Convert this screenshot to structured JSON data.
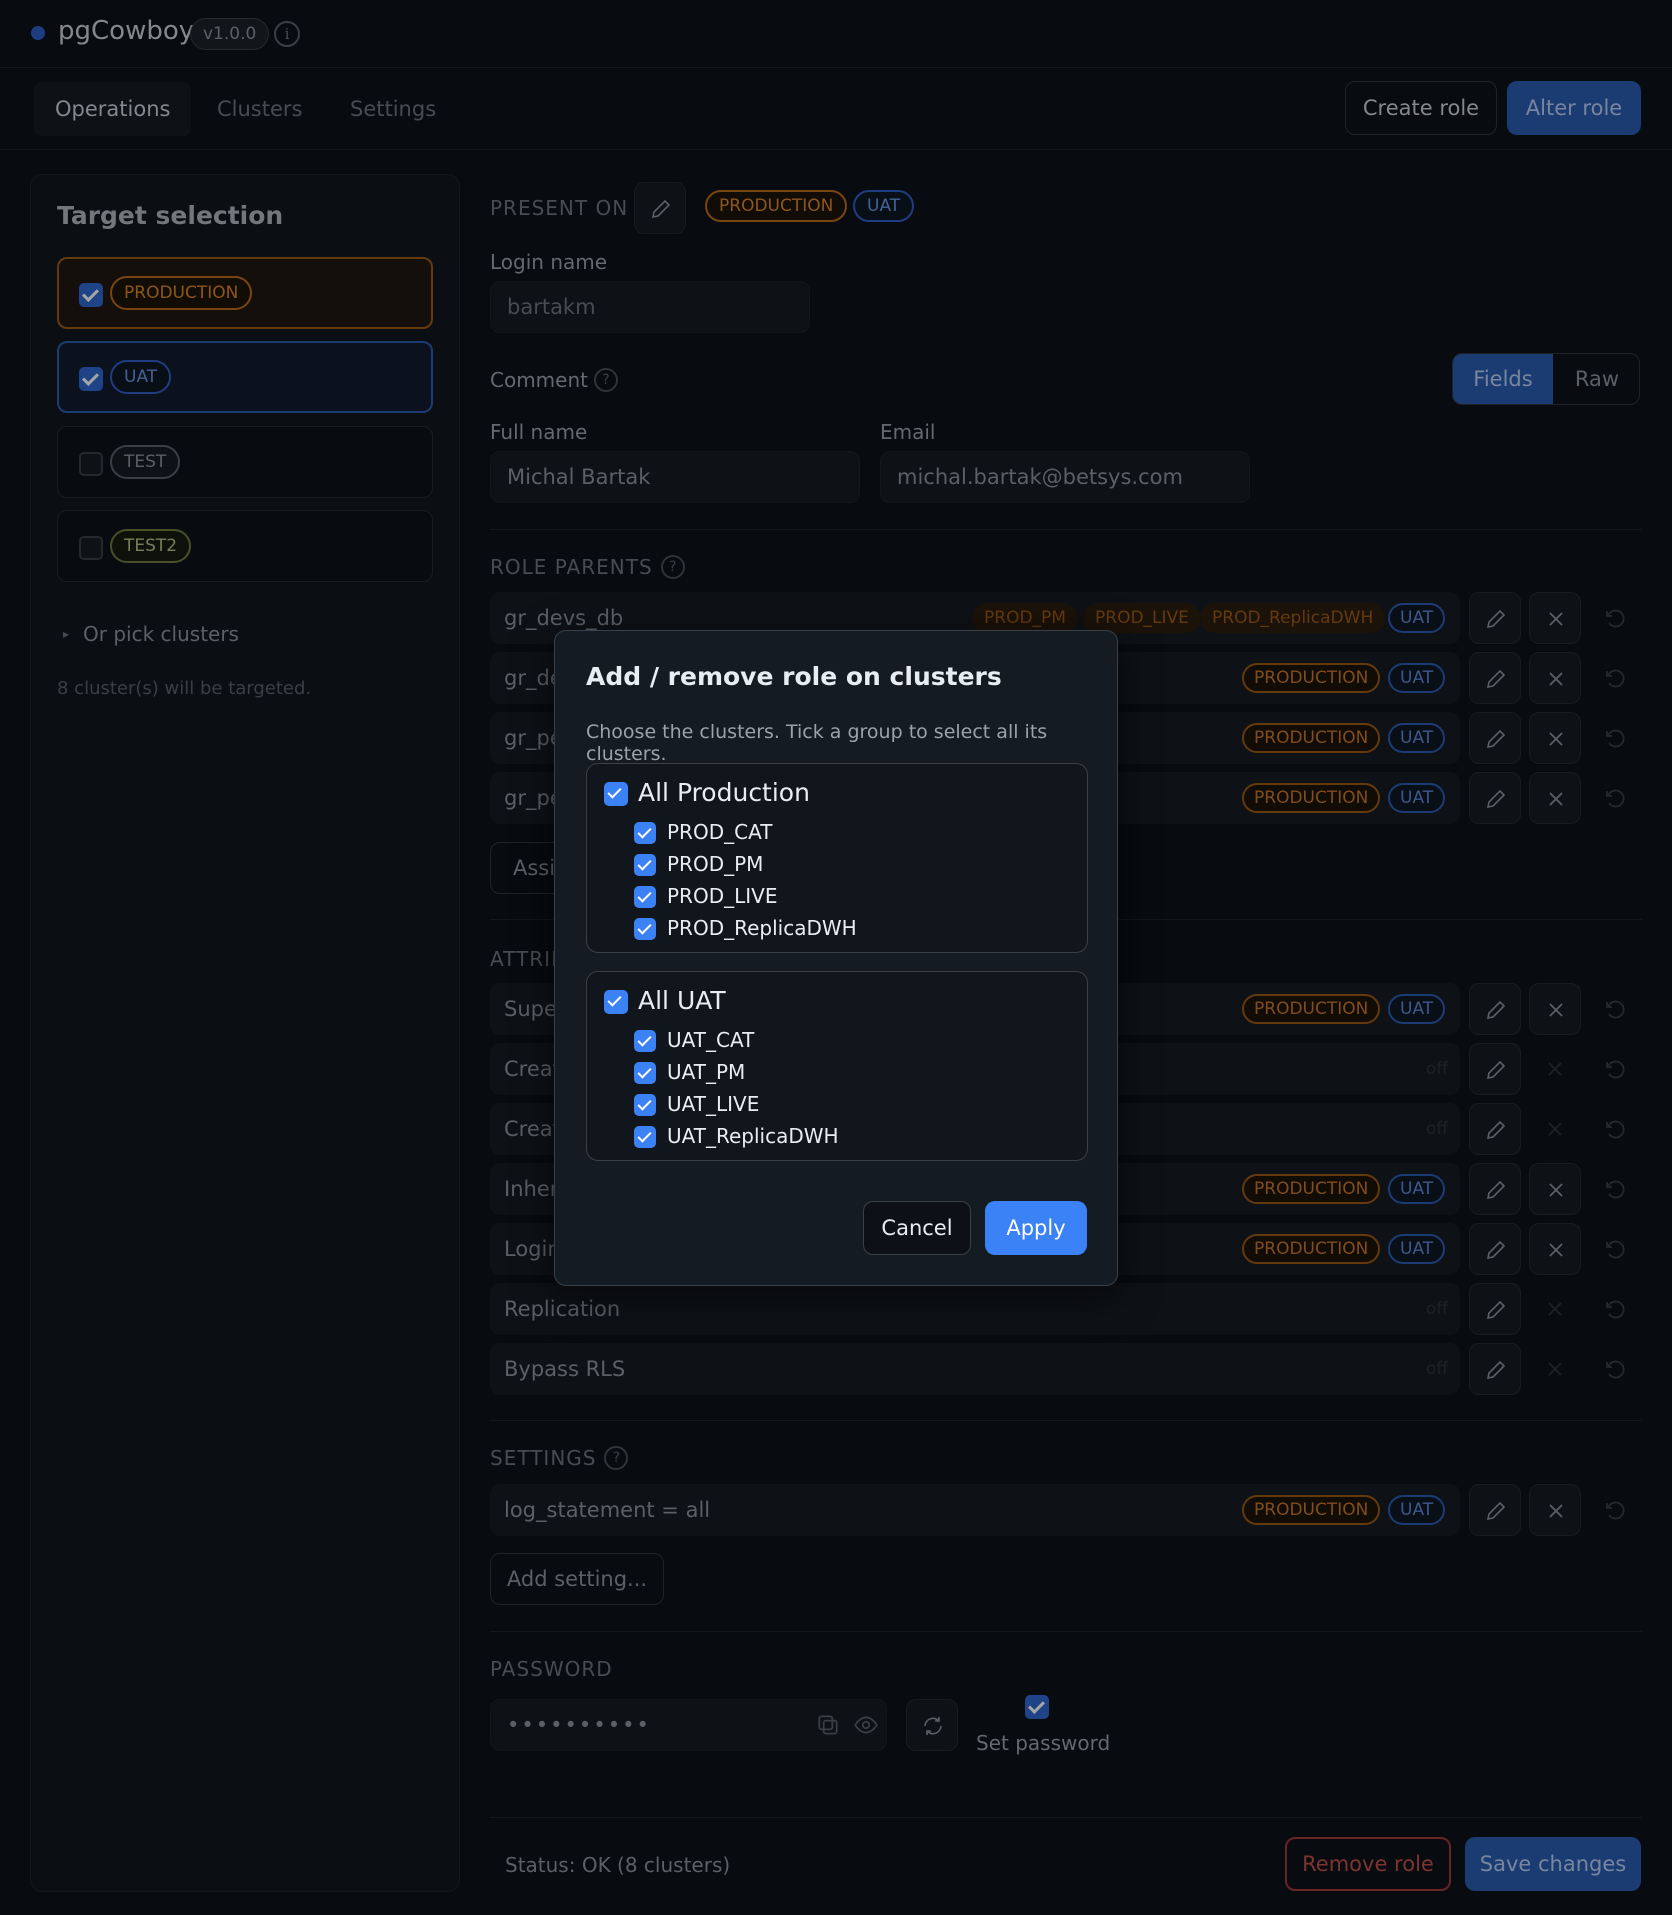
{
  "app": {
    "title": "pgCowboy",
    "version": "v1.0.0"
  },
  "nav": {
    "tabs": [
      "Operations",
      "Clusters",
      "Settings"
    ],
    "create_role": "Create role",
    "alter_role": "Alter role"
  },
  "sidebar": {
    "title": "Target selection",
    "targets": [
      {
        "label": "PRODUCTION",
        "checked": true
      },
      {
        "label": "UAT",
        "checked": true
      },
      {
        "label": "TEST",
        "checked": false
      },
      {
        "label": "TEST2",
        "checked": false
      }
    ],
    "pick_clusters": "Or pick clusters",
    "targeted_note": "8 cluster(s) will be targeted."
  },
  "main": {
    "present_on_label": "PRESENT ON",
    "present_on_tags": [
      "PRODUCTION",
      "UAT"
    ],
    "login_name_label": "Login name",
    "login_name_value": "bartakm",
    "comment_label": "Comment",
    "mode_fields": "Fields",
    "mode_raw": "Raw",
    "full_name_label": "Full name",
    "full_name_value": "Michal Bartak",
    "email_label": "Email",
    "email_value": "michal.bartak@betsys.com",
    "role_parents_label": "ROLE PARENTS",
    "role_parents": [
      {
        "name": "gr_devs_db",
        "tags": [
          "PROD_PM",
          "PROD_LIVE",
          "PROD_ReplicaDWH"
        ],
        "uat": "UAT"
      },
      {
        "name": "gr_de",
        "tags": [
          "PRODUCTION"
        ],
        "uat": "UAT"
      },
      {
        "name": "gr_pe",
        "tags": [
          "PRODUCTION"
        ],
        "uat": "UAT"
      },
      {
        "name": "gr_pe",
        "tags": [
          "PRODUCTION"
        ],
        "uat": "UAT"
      }
    ],
    "assign_partial": "Assi",
    "attributes_label": "ATTRIB",
    "attributes": [
      {
        "name": "Supe",
        "tags": [
          "PRODUCTION",
          "UAT"
        ],
        "off": ""
      },
      {
        "name": "Creat",
        "tags": [],
        "off": "off"
      },
      {
        "name": "Creat",
        "tags": [],
        "off": "off"
      },
      {
        "name": "Inher",
        "tags": [
          "PRODUCTION",
          "UAT"
        ],
        "off": ""
      },
      {
        "name": "Login",
        "tags": [
          "PRODUCTION",
          "UAT"
        ],
        "off": ""
      },
      {
        "name": "Replication",
        "tags": [],
        "off": "off"
      },
      {
        "name": "Bypass RLS",
        "tags": [],
        "off": "off"
      }
    ],
    "settings_label": "SETTINGS",
    "setting_row": {
      "name": "log_statement = all",
      "tags": [
        "PRODUCTION",
        "UAT"
      ]
    },
    "add_setting": "Add setting...",
    "password_label": "PASSWORD",
    "password_value": "••••••••••",
    "set_password": "Set password",
    "status": "Status: OK (8 clusters)",
    "remove_role": "Remove role",
    "save_changes": "Save changes"
  },
  "modal": {
    "title": "Add / remove role on clusters",
    "description": "Choose the clusters. Tick a group to select all its clusters.",
    "groups": [
      {
        "name": "All Production",
        "items": [
          "PROD_CAT",
          "PROD_PM",
          "PROD_LIVE",
          "PROD_ReplicaDWH"
        ]
      },
      {
        "name": "All UAT",
        "items": [
          "UAT_CAT",
          "UAT_PM",
          "UAT_LIVE",
          "UAT_ReplicaDWH"
        ]
      }
    ],
    "cancel": "Cancel",
    "apply": "Apply"
  },
  "colors": {
    "accent": "#2a5db0",
    "production": "#b86b1c",
    "uat": "#2f5fc7",
    "apply": "#3b82f6",
    "danger": "#c0392b"
  }
}
